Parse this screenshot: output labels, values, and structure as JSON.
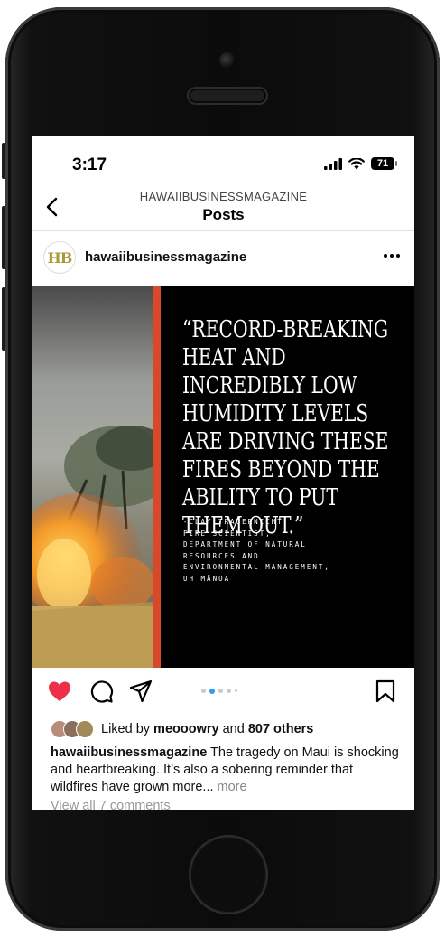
{
  "status_bar": {
    "time": "3:17",
    "battery": "71"
  },
  "nav": {
    "account_caps": "HAWAIIBUSINESSMAGAZINE",
    "title": "Posts"
  },
  "post": {
    "avatar_initials": "HB",
    "username": "hawaiibusinessmagazine",
    "quote": "“RECORD-BREAKING HEAT AND INCREDIBLY LOW HUMIDITY LEVELS ARE DRIVING THESE FIRES BEYOND THE ABILITY TO PUT THEM OUT.”",
    "attribution": "-CLAY TRAUERNICHT,\nFIRE SCIENTIST,\nDEPARTMENT OF NATURAL\nRESOURCES AND\nENVIRONMENTAL MANAGEMENT,\nUH MĀNOA",
    "liked": true
  },
  "likes": {
    "prefix": "Liked by ",
    "user": "meooowry",
    "middle": " and ",
    "count": "807 others"
  },
  "caption": {
    "username": "hawaiibusinessmagazine",
    "text": " The tragedy on Maui is shocking and heartbreaking. It’s also a sobering reminder that wildfires have grown more...",
    "more": " more"
  },
  "comments_link": "View all 7 comments",
  "colors": {
    "like_red": "#ed2f47",
    "accent_bar": "#d8482a",
    "dot_active": "#3897f0"
  },
  "icons": [
    "back-chevron-icon",
    "more-dots-icon",
    "heart-icon",
    "comment-icon",
    "share-icon",
    "bookmark-icon",
    "signal-icon",
    "wifi-icon",
    "battery-icon"
  ]
}
